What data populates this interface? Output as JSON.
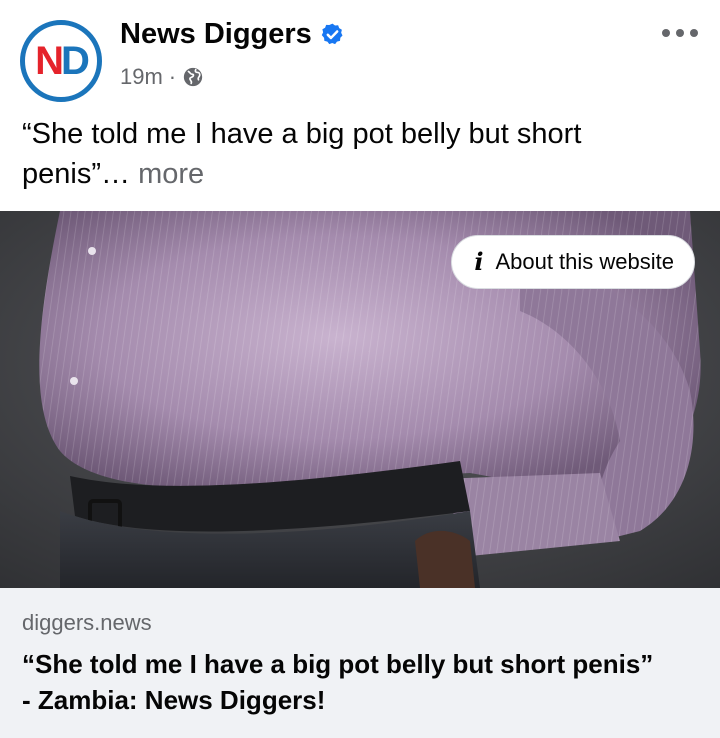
{
  "post": {
    "page_name": "News Diggers",
    "avatar_letters": {
      "first": "N",
      "second": "D"
    },
    "timestamp": "19m",
    "separator": "·",
    "audience_icon": "globe-icon",
    "verified_icon": "verified-badge-icon",
    "menu_icon": "more-horizontal-icon",
    "caption": "“She told me I have a big pot belly but short penis”",
    "caption_ellipsis": "…",
    "see_more_label": "more"
  },
  "link_preview": {
    "image_description_icon": "photo",
    "about_button_label": "About this website",
    "about_icon": "info-icon",
    "domain": "diggers.news",
    "title_line1": "“She told me I have a big pot belly but short penis”",
    "title_line2": "- Zambia: News Diggers!"
  },
  "colors": {
    "brand_blue": "#1b75bb",
    "brand_red": "#e5232b",
    "verified_blue": "#1877f2",
    "secondary_text": "#65676b",
    "footer_bg": "#f0f2f5"
  }
}
